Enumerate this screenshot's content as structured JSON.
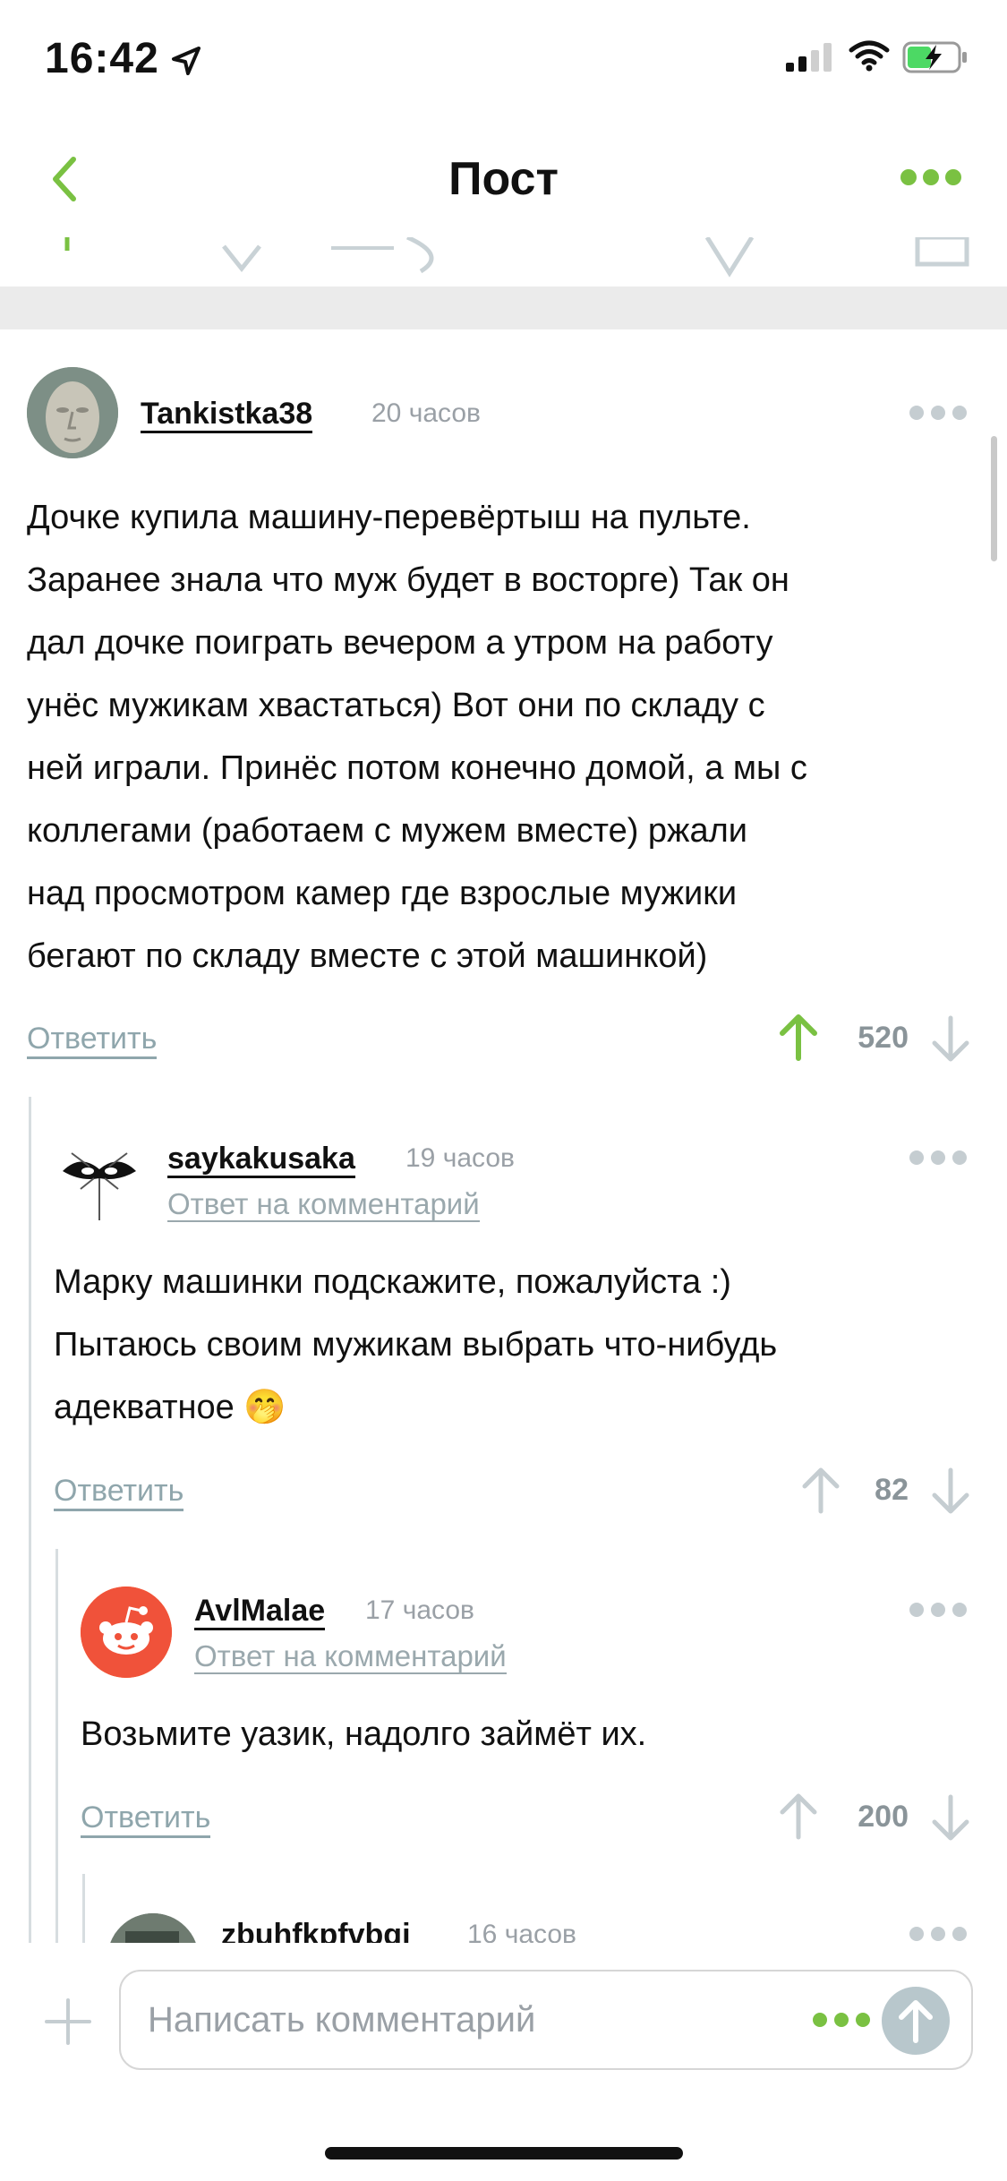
{
  "status_bar": {
    "time": "16:42"
  },
  "nav": {
    "title": "Пост"
  },
  "comments": [
    {
      "author": "Tankistka38",
      "time": "20 часов",
      "text_lines": [
        "Дочке купила машину-перевёртыш на пульте.",
        "Заранее знала что муж будет в восторге) Так он",
        "дал дочке поиграть вечером а утром на работу",
        "унёс мужикам хвастаться) Вот они по складу с",
        "ней играли. Принёс потом конечно домой, а мы с",
        "коллегами (работаем с мужем вместе) ржали",
        "над просмотром камер где взрослые мужики",
        "бегают по складу вместе с этой машинкой)"
      ],
      "reply_label": "Ответить",
      "score": "520"
    },
    {
      "author": "saykakusaka",
      "time": "19 часов",
      "reply_prefix": "Ответ на ",
      "reply_link": "комментарий",
      "text_lines": [
        "Марку машинки подскажите, пожалуйста :)",
        "Пытаюсь своим мужикам выбрать что-нибудь",
        "адекватное 🤭"
      ],
      "reply_label": "Ответить",
      "score": "82"
    },
    {
      "author": "AvlMalae",
      "time": "17 часов",
      "reply_prefix": "Ответ на ",
      "reply_link": "комментарий",
      "text_lines": [
        "Возьмите уазик, надолго займёт их."
      ],
      "reply_label": "Ответить",
      "score": "200"
    },
    {
      "author": "zbuhfkpfvbgj",
      "time": "16 часов"
    }
  ],
  "composer": {
    "placeholder": "Написать комментарий"
  },
  "colors": {
    "accent": "#7ac142",
    "muted": "#8fa6ac"
  }
}
